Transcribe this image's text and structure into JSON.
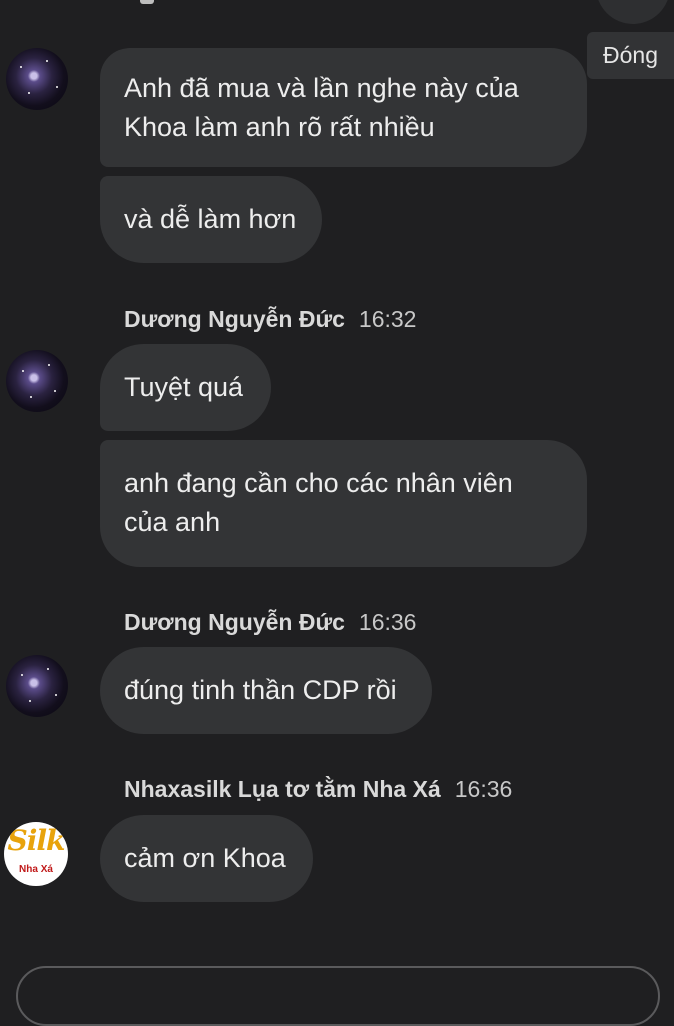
{
  "close_label": "Đóng",
  "messages": [
    {
      "text_lines": [
        "Anh đã mua và lần nghe này của",
        "Khoa làm anh rõ rất nhiều"
      ]
    },
    {
      "text": "và dễ làm hơn"
    },
    {
      "sender": "Dương Nguyễn Đức",
      "time": "16:32"
    },
    {
      "text": "Tuyệt quá"
    },
    {
      "text_lines": [
        "anh đang cần cho các nhân viên",
        "của anh"
      ]
    },
    {
      "sender": "Dương Nguyễn Đức",
      "time": "16:36"
    },
    {
      "text": "đúng tinh thần CDP rồi"
    },
    {
      "sender": "Nhaxasilk Lụa tơ tằm Nha Xá",
      "time": "16:36"
    },
    {
      "text": "cảm ơn Khoa"
    }
  ],
  "logo": {
    "brand_text": "Silk",
    "sub_text": "Nha Xá"
  }
}
